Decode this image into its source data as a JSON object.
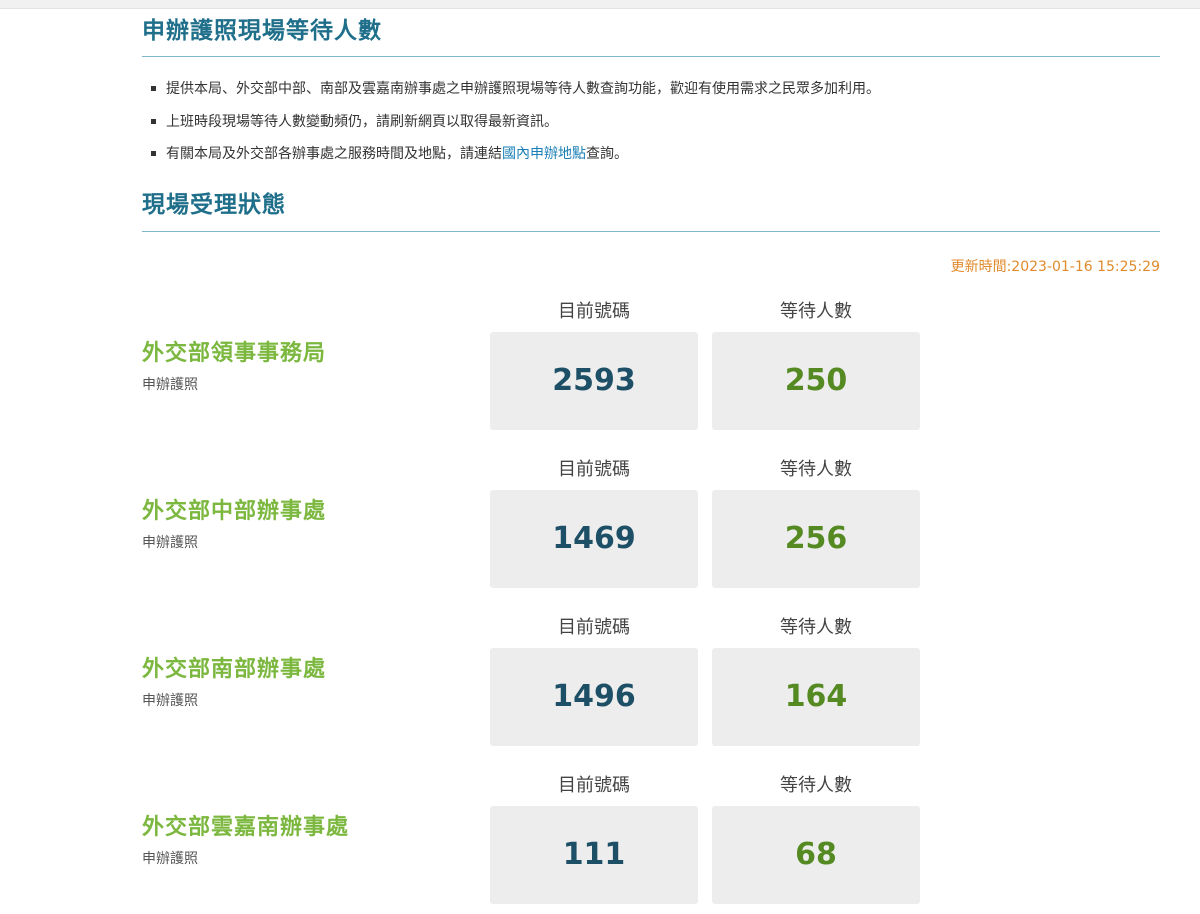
{
  "page": {
    "title": "申辦護照現場等待人數",
    "status_title": "現場受理狀態",
    "update_time": "更新時間:2023-01-16 15:25:29"
  },
  "notes": {
    "item1": "提供本局、外交部中部、南部及雲嘉南辦事處之申辦護照現場等待人數查詢功能，歡迎有使用需求之民眾多加利用。",
    "item2": "上班時段現場等待人數變動頻仍，請刷新網頁以取得最新資訊。",
    "item3_before": "有關本局及外交部各辦事處之服務時間及地點，請連結",
    "item3_link": "國內申辦地點",
    "item3_after": "查詢。"
  },
  "columns": {
    "current": "目前號碼",
    "waiting": "等待人數"
  },
  "offices": [
    {
      "name": "外交部領事事務局",
      "service": "申辦護照",
      "current": "2593",
      "waiting": "250"
    },
    {
      "name": "外交部中部辦事處",
      "service": "申辦護照",
      "current": "1469",
      "waiting": "256"
    },
    {
      "name": "外交部南部辦事處",
      "service": "申辦護照",
      "current": "1496",
      "waiting": "164"
    },
    {
      "name": "外交部雲嘉南辦事處",
      "service": "申辦護照",
      "current": "111",
      "waiting": "68"
    }
  ],
  "colors": {
    "title": "#1f6f8b",
    "office_name": "#7cb83f",
    "current_number": "#1d4f66",
    "waiting_number": "#558a23",
    "update_time": "#e08a2c",
    "link": "#1a7fb5"
  }
}
